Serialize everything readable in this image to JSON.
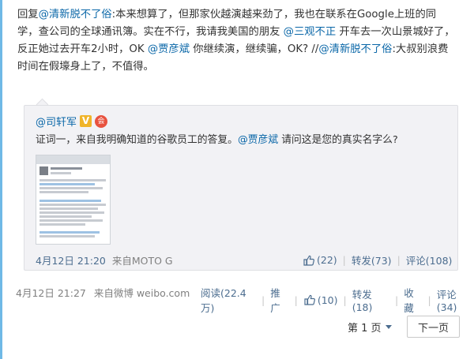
{
  "post": {
    "reply_prefix": "回复",
    "mention_1": "@清新脱不了俗",
    "text_1": ":本来想算了，但那家伙越演越来劲了，我也在联系在Google上班的同学，查公司的全球通讯簿。实在不行，我请我美国的朋友 ",
    "mention_2": "@三观不正",
    "text_2": " 开车去一次山景城好了，反正她过去开车2小时，OK ",
    "mention_3": "@贾彦斌",
    "text_3": " 你继续演，继续骗，OK?  //",
    "mention_4": "@清新脱不了俗",
    "text_4": ":大叔别浪费时间在假壕身上了，不值得。"
  },
  "repost": {
    "author": "@司轩军",
    "badge_v": "V",
    "badge_club": "会",
    "text_1": "证词一，来自我明确知道的谷歌员工的答复。",
    "mention": "@贾彦斌",
    "text_2": " 请问这是您的真实名字么?",
    "time": "4月12日 21:20",
    "source": "来自MOTO G",
    "like_count": "(22)",
    "forward": "转发(73)",
    "comment": "评论(108)"
  },
  "meta": {
    "time": "4月12日 21:27",
    "source": "来自微博 weibo.com",
    "reads": "阅读(22.4万)",
    "promote": "推广",
    "like_count": "(10)",
    "forward": "转发(18)",
    "favorite": "收藏",
    "comment": "评论(34)"
  },
  "pager": {
    "page_label": "第 1 页",
    "next_label": "下一页"
  },
  "colors": {
    "link": "#0a67a8",
    "action": "#4c6d8f",
    "meta_gray": "#808080",
    "repost_bg": "#f2f2f5",
    "accent_edge": "#6fb9e6"
  }
}
